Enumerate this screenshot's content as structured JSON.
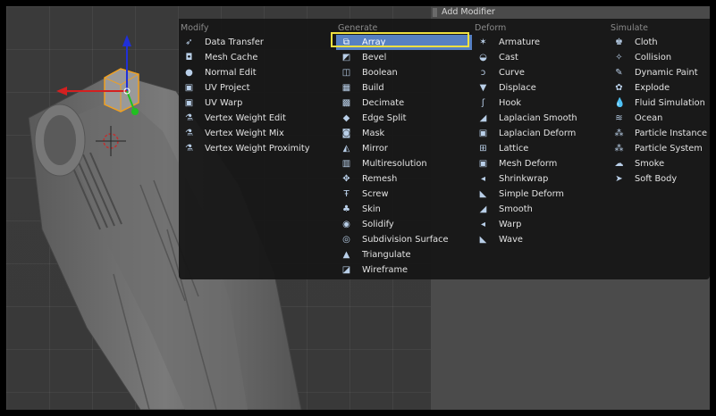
{
  "header": {
    "title": "Add Modifier"
  },
  "menu": {
    "columns": [
      {
        "title": "Modify",
        "items": [
          {
            "label": "Data Transfer",
            "icon": "data-transfer-icon",
            "glyph": "➶"
          },
          {
            "label": "Mesh Cache",
            "icon": "mesh-cache-icon",
            "glyph": "◘"
          },
          {
            "label": "Normal Edit",
            "icon": "normal-edit-icon",
            "glyph": "●"
          },
          {
            "label": "UV Project",
            "icon": "uv-project-icon",
            "glyph": "▣"
          },
          {
            "label": "UV Warp",
            "icon": "uv-warp-icon",
            "glyph": "▣"
          },
          {
            "label": "Vertex Weight Edit",
            "icon": "vertex-weight-edit-icon",
            "glyph": "⚗"
          },
          {
            "label": "Vertex Weight Mix",
            "icon": "vertex-weight-mix-icon",
            "glyph": "⚗"
          },
          {
            "label": "Vertex Weight Proximity",
            "icon": "vertex-weight-proximity-icon",
            "glyph": "⚗"
          }
        ]
      },
      {
        "title": "Generate",
        "items": [
          {
            "label": "Array",
            "icon": "array-icon",
            "glyph": "⧉",
            "highlighted": true
          },
          {
            "label": "Bevel",
            "icon": "bevel-icon",
            "glyph": "◩"
          },
          {
            "label": "Boolean",
            "icon": "boolean-icon",
            "glyph": "◫"
          },
          {
            "label": "Build",
            "icon": "build-icon",
            "glyph": "▦"
          },
          {
            "label": "Decimate",
            "icon": "decimate-icon",
            "glyph": "▩"
          },
          {
            "label": "Edge Split",
            "icon": "edge-split-icon",
            "glyph": "◆"
          },
          {
            "label": "Mask",
            "icon": "mask-icon",
            "glyph": "◙"
          },
          {
            "label": "Mirror",
            "icon": "mirror-icon",
            "glyph": "◭"
          },
          {
            "label": "Multiresolution",
            "icon": "multiresolution-icon",
            "glyph": "▥"
          },
          {
            "label": "Remesh",
            "icon": "remesh-icon",
            "glyph": "✥"
          },
          {
            "label": "Screw",
            "icon": "screw-icon",
            "glyph": "Ŧ"
          },
          {
            "label": "Skin",
            "icon": "skin-icon",
            "glyph": "♣"
          },
          {
            "label": "Solidify",
            "icon": "solidify-icon",
            "glyph": "◉"
          },
          {
            "label": "Subdivision Surface",
            "icon": "subdivision-surface-icon",
            "glyph": "◎"
          },
          {
            "label": "Triangulate",
            "icon": "triangulate-icon",
            "glyph": "▲"
          },
          {
            "label": "Wireframe",
            "icon": "wireframe-icon",
            "glyph": "◪"
          }
        ]
      },
      {
        "title": "Deform",
        "items": [
          {
            "label": "Armature",
            "icon": "armature-icon",
            "glyph": "✶"
          },
          {
            "label": "Cast",
            "icon": "cast-icon",
            "glyph": "◒"
          },
          {
            "label": "Curve",
            "icon": "curve-icon",
            "glyph": "ↄ"
          },
          {
            "label": "Displace",
            "icon": "displace-icon",
            "glyph": "▼"
          },
          {
            "label": "Hook",
            "icon": "hook-icon",
            "glyph": "ʃ"
          },
          {
            "label": "Laplacian Smooth",
            "icon": "laplacian-smooth-icon",
            "glyph": "◢"
          },
          {
            "label": "Laplacian Deform",
            "icon": "laplacian-deform-icon",
            "glyph": "▣"
          },
          {
            "label": "Lattice",
            "icon": "lattice-icon",
            "glyph": "⊞"
          },
          {
            "label": "Mesh Deform",
            "icon": "mesh-deform-icon",
            "glyph": "▣"
          },
          {
            "label": "Shrinkwrap",
            "icon": "shrinkwrap-icon",
            "glyph": "◂"
          },
          {
            "label": "Simple Deform",
            "icon": "simple-deform-icon",
            "glyph": "◣"
          },
          {
            "label": "Smooth",
            "icon": "smooth-icon",
            "glyph": "◢"
          },
          {
            "label": "Warp",
            "icon": "warp-icon",
            "glyph": "◂"
          },
          {
            "label": "Wave",
            "icon": "wave-icon",
            "glyph": "◣"
          }
        ]
      },
      {
        "title": "Simulate",
        "items": [
          {
            "label": "Cloth",
            "icon": "cloth-icon",
            "glyph": "♚"
          },
          {
            "label": "Collision",
            "icon": "collision-icon",
            "glyph": "✧"
          },
          {
            "label": "Dynamic Paint",
            "icon": "dynamic-paint-icon",
            "glyph": "✎"
          },
          {
            "label": "Explode",
            "icon": "explode-icon",
            "glyph": "✿"
          },
          {
            "label": "Fluid Simulation",
            "icon": "fluid-simulation-icon",
            "glyph": "💧"
          },
          {
            "label": "Ocean",
            "icon": "ocean-icon",
            "glyph": "≋"
          },
          {
            "label": "Particle Instance",
            "icon": "particle-instance-icon",
            "glyph": "⁂"
          },
          {
            "label": "Particle System",
            "icon": "particle-system-icon",
            "glyph": "⁂"
          },
          {
            "label": "Smoke",
            "icon": "smoke-icon",
            "glyph": "☁"
          },
          {
            "label": "Soft Body",
            "icon": "soft-body-icon",
            "glyph": "➤"
          }
        ]
      }
    ]
  },
  "colors": {
    "menu_bg": "#161616",
    "highlight": "#5680c2",
    "callout": "#f0e040",
    "header_text": "#8a8a8a",
    "axis_x": "#d42020",
    "axis_y": "#2030d8",
    "axis_z": "#20c020",
    "selection": "#f0a020"
  }
}
